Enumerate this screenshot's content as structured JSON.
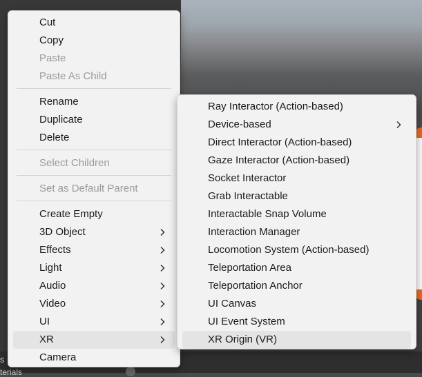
{
  "context_menu": {
    "items": [
      {
        "label": "Cut",
        "disabled": false
      },
      {
        "label": "Copy",
        "disabled": false
      },
      {
        "label": "Paste",
        "disabled": true
      },
      {
        "label": "Paste As Child",
        "disabled": true
      },
      {
        "label": "Rename",
        "disabled": false
      },
      {
        "label": "Duplicate",
        "disabled": false
      },
      {
        "label": "Delete",
        "disabled": false
      },
      {
        "label": "Select Children",
        "disabled": true
      },
      {
        "label": "Set as Default Parent",
        "disabled": true
      },
      {
        "label": "Create Empty",
        "disabled": false
      },
      {
        "label": "3D Object",
        "has_submenu": true
      },
      {
        "label": "Effects",
        "has_submenu": true
      },
      {
        "label": "Light",
        "has_submenu": true
      },
      {
        "label": "Audio",
        "has_submenu": true
      },
      {
        "label": "Video",
        "has_submenu": true
      },
      {
        "label": "UI",
        "has_submenu": true
      },
      {
        "label": "XR",
        "has_submenu": true,
        "highlighted": true
      },
      {
        "label": "Camera",
        "disabled": false
      }
    ]
  },
  "xr_submenu": {
    "items": [
      {
        "label": "Ray Interactor (Action-based)"
      },
      {
        "label": "Device-based",
        "has_submenu": true
      },
      {
        "label": "Direct Interactor (Action-based)"
      },
      {
        "label": "Gaze Interactor (Action-based)"
      },
      {
        "label": "Socket Interactor"
      },
      {
        "label": "Grab Interactable"
      },
      {
        "label": "Interactable Snap Volume"
      },
      {
        "label": "Interaction Manager"
      },
      {
        "label": "Locomotion System (Action-based)"
      },
      {
        "label": "Teleportation Area"
      },
      {
        "label": "Teleportation Anchor"
      },
      {
        "label": "UI Canvas"
      },
      {
        "label": "UI Event System"
      },
      {
        "label": "XR Origin (VR)",
        "highlighted": true
      }
    ]
  },
  "background": {
    "panel_label": "s",
    "panel_sublabel": "terials"
  },
  "colors": {
    "menu_bg": "#f2f2f2",
    "highlight_bg": "#e4e4e4",
    "disabled_text": "#9a9a9a",
    "scene_orange": "#e4692a"
  }
}
